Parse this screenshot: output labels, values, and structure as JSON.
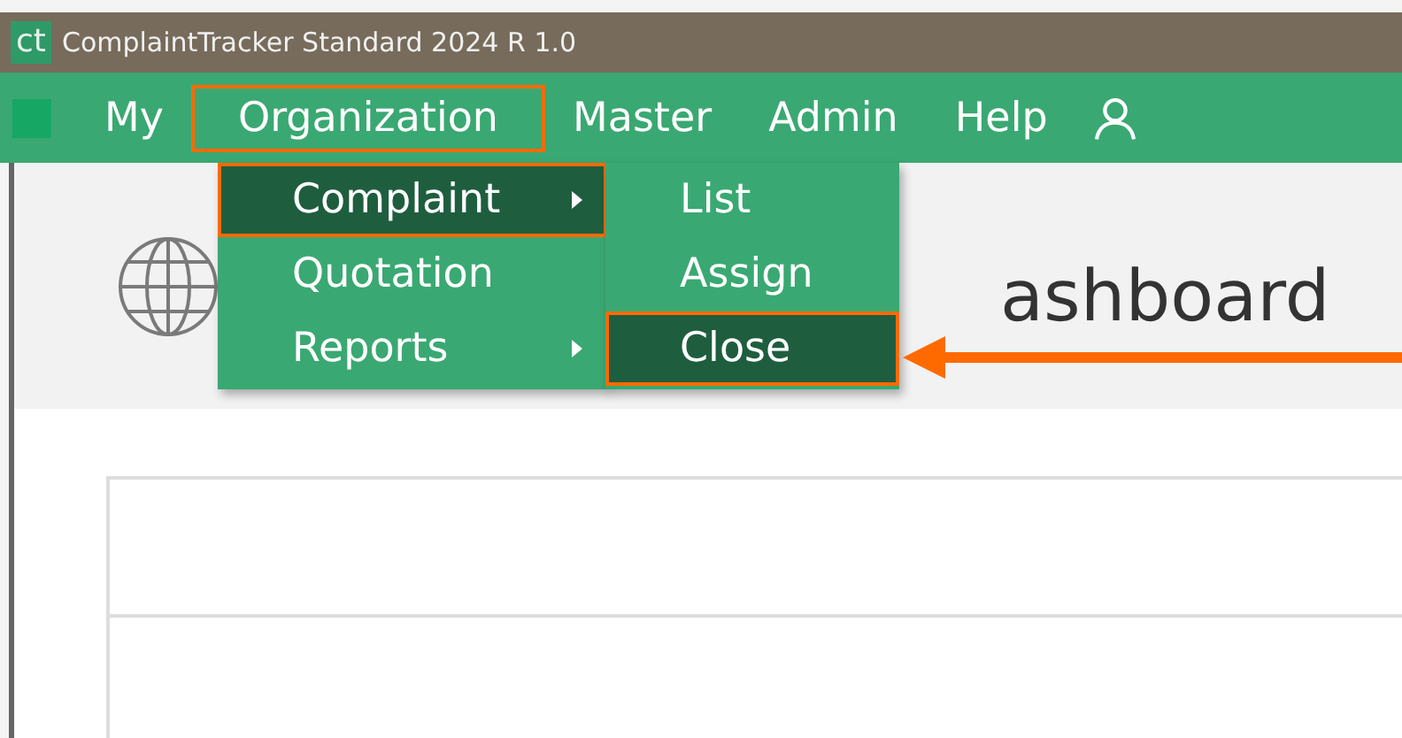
{
  "window": {
    "logo": "ct",
    "title": "ComplaintTracker Standard 2024 R 1.0"
  },
  "menu_bar": [
    {
      "label": "My",
      "selected": false
    },
    {
      "label": "Organization",
      "selected": true
    },
    {
      "label": "Master",
      "selected": false
    },
    {
      "label": "Admin",
      "selected": false
    },
    {
      "label": "Help",
      "selected": false
    }
  ],
  "dropdown": [
    {
      "label": "Complaint",
      "selected": true,
      "has_submenu": true
    },
    {
      "label": "Quotation",
      "selected": false,
      "has_submenu": false
    },
    {
      "label": "Reports",
      "selected": false,
      "has_submenu": true
    }
  ],
  "submenu": [
    {
      "label": "List",
      "selected": false
    },
    {
      "label": "Assign",
      "selected": false
    },
    {
      "label": "Close",
      "selected": true
    }
  ],
  "page": {
    "title": "ashboard"
  }
}
